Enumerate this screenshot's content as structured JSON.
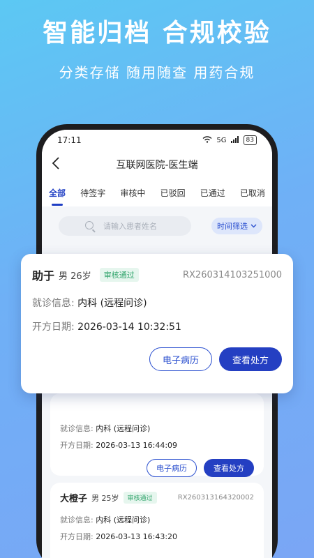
{
  "hero": {
    "title": "智能归档 合规校验",
    "subtitle": "分类存储 随用随查 用药合规"
  },
  "status_bar": {
    "time": "17:11",
    "network": "5G",
    "battery": "83"
  },
  "navbar": {
    "title": "互联网医院-医生端"
  },
  "tabs": [
    {
      "label": "全部",
      "active": true
    },
    {
      "label": "待签字",
      "active": false
    },
    {
      "label": "审核中",
      "active": false
    },
    {
      "label": "已驳回",
      "active": false
    },
    {
      "label": "已通过",
      "active": false
    },
    {
      "label": "已取消",
      "active": false
    }
  ],
  "search": {
    "placeholder": "请输入患者姓名",
    "filter_label": "时间筛选"
  },
  "labels": {
    "visit_info": "就诊信息:",
    "prescribe_date": "开方日期:",
    "emr_button": "电子病历",
    "view_rx_button": "查看处方"
  },
  "prescriptions": [
    {
      "name": "助于",
      "meta": "男 26岁",
      "status": "审核通过",
      "rx_no": "RX260314103251000",
      "visit": "内科 (远程问诊)",
      "date": "2026-03-14 10:32:51"
    },
    {
      "visit": "内科 (远程问诊)",
      "date": "2026-03-13 16:44:09"
    },
    {
      "name": "大橙子",
      "meta": "男 25岁",
      "status": "审核通过",
      "rx_no": "RX260313164320002",
      "visit": "内科 (远程问诊)",
      "date": "2026-03-13 16:43:20"
    }
  ],
  "colors": {
    "accent": "#243fc2",
    "badge_green": "#33a56d"
  }
}
